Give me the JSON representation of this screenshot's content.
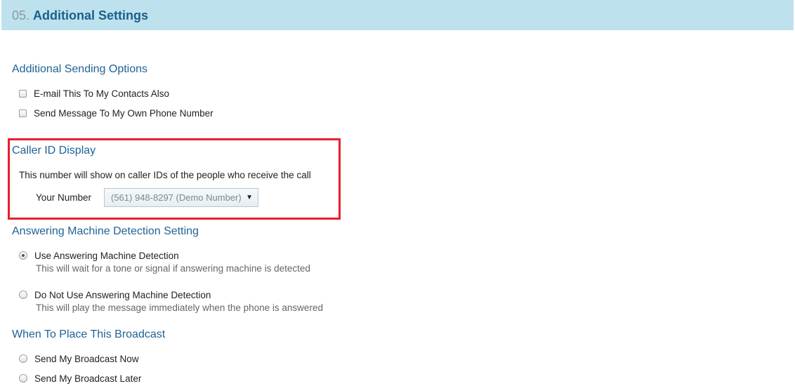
{
  "header": {
    "number": "05.",
    "title": "Additional Settings"
  },
  "sending_options": {
    "title": "Additional Sending Options",
    "items": [
      {
        "label": "E-mail This To My Contacts Also",
        "checked": false
      },
      {
        "label": "Send Message To My Own Phone Number",
        "checked": false
      }
    ]
  },
  "caller_id": {
    "title": "Caller ID Display",
    "description": "This number will show on caller IDs of the people who receive the call",
    "number_label": "Your Number",
    "selected_number": "(561) 948-8297 (Demo Number)",
    "highlight_color": "#e5202e"
  },
  "answering_machine": {
    "title": "Answering Machine Detection Setting",
    "options": [
      {
        "label": "Use Answering Machine Detection",
        "description": "This will wait for a tone or signal if answering machine is detected",
        "selected": true
      },
      {
        "label": "Do Not Use Answering Machine Detection",
        "description": "This will play the message immediately when the phone is answered",
        "selected": false
      }
    ]
  },
  "schedule": {
    "title": "When To Place This Broadcast",
    "options": [
      {
        "label": "Send My Broadcast Now",
        "selected": false
      },
      {
        "label": "Send My Broadcast Later",
        "selected": false
      }
    ]
  },
  "colors": {
    "header_bg": "#bde2ed",
    "section_title": "#1f6396",
    "header_title": "#1a5f8d"
  },
  "icons": {
    "dropdown": "chevron-down-icon"
  }
}
